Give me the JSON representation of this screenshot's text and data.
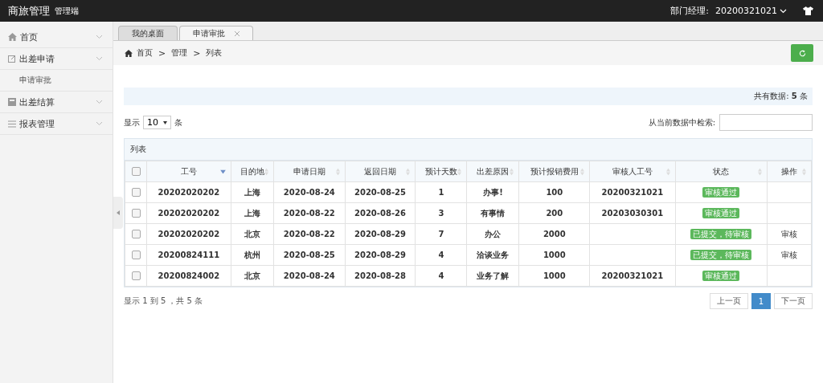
{
  "header": {
    "app_title": "商旅管理",
    "app_subtitle": "管理端",
    "role_label": "部门经理:",
    "user_id": "20200321021"
  },
  "sidebar": {
    "items": [
      {
        "label": "首页"
      },
      {
        "label": "出差申请",
        "children": [
          {
            "label": "申请审批"
          }
        ]
      },
      {
        "label": "出差结算"
      },
      {
        "label": "报表管理"
      }
    ]
  },
  "tabs": [
    {
      "label": "我的桌面",
      "selected": false,
      "closable": false
    },
    {
      "label": "申请审批",
      "selected": true,
      "closable": true
    }
  ],
  "breadcrumb": {
    "items": [
      "首页",
      "管理",
      "列表"
    ],
    "separator": ">"
  },
  "info_bar": {
    "label": "共有数据:",
    "count": "5",
    "unit": "条"
  },
  "page_size": {
    "prefix": "显示",
    "value": "10",
    "suffix": "条"
  },
  "search": {
    "label": "从当前数据中检索:"
  },
  "table": {
    "title": "列表",
    "header_checked": false,
    "columns": [
      {
        "label": "工号",
        "sorted": true
      },
      {
        "label": "目的地",
        "sorted": false
      },
      {
        "label": "申请日期",
        "sorted": false
      },
      {
        "label": "返回日期",
        "sorted": false
      },
      {
        "label": "预计天数",
        "sorted": false
      },
      {
        "label": "出差原因",
        "sorted": false
      },
      {
        "label": "预计报销费用",
        "sorted": false
      },
      {
        "label": "审核人工号",
        "sorted": false
      },
      {
        "label": "状态",
        "sorted": false
      },
      {
        "label": "操作",
        "sorted": false
      }
    ],
    "rows": [
      {
        "checked": false,
        "cells": [
          "20202020202",
          "上海",
          "2020-08-24",
          "2020-08-25",
          "1",
          "办事!",
          "100",
          "20200321021"
        ],
        "status": "审核通过",
        "action": ""
      },
      {
        "checked": false,
        "cells": [
          "20202020202",
          "上海",
          "2020-08-22",
          "2020-08-26",
          "3",
          "有事情",
          "200",
          "20203030301"
        ],
        "status": "审核通过",
        "action": ""
      },
      {
        "checked": false,
        "cells": [
          "20202020202",
          "北京",
          "2020-08-22",
          "2020-08-29",
          "7",
          "办公",
          "2000",
          ""
        ],
        "status": "已提交，待审核",
        "action": "审核"
      },
      {
        "checked": false,
        "cells": [
          "20200824111",
          "杭州",
          "2020-08-25",
          "2020-08-29",
          "4",
          "洽谈业务",
          "1000",
          ""
        ],
        "status": "已提交，待审核",
        "action": "审核"
      },
      {
        "checked": false,
        "cells": [
          "20200824002",
          "北京",
          "2020-08-24",
          "2020-08-28",
          "4",
          "业务了解",
          "1000",
          "20200321021"
        ],
        "status": "审核通过",
        "action": ""
      }
    ]
  },
  "footer": {
    "summary": "显示 1 到 5 ，共 5 条"
  },
  "pagination": [
    {
      "label": "上一页",
      "selected": false
    },
    {
      "label": "1",
      "selected": true
    },
    {
      "label": "下一页",
      "selected": false
    }
  ]
}
